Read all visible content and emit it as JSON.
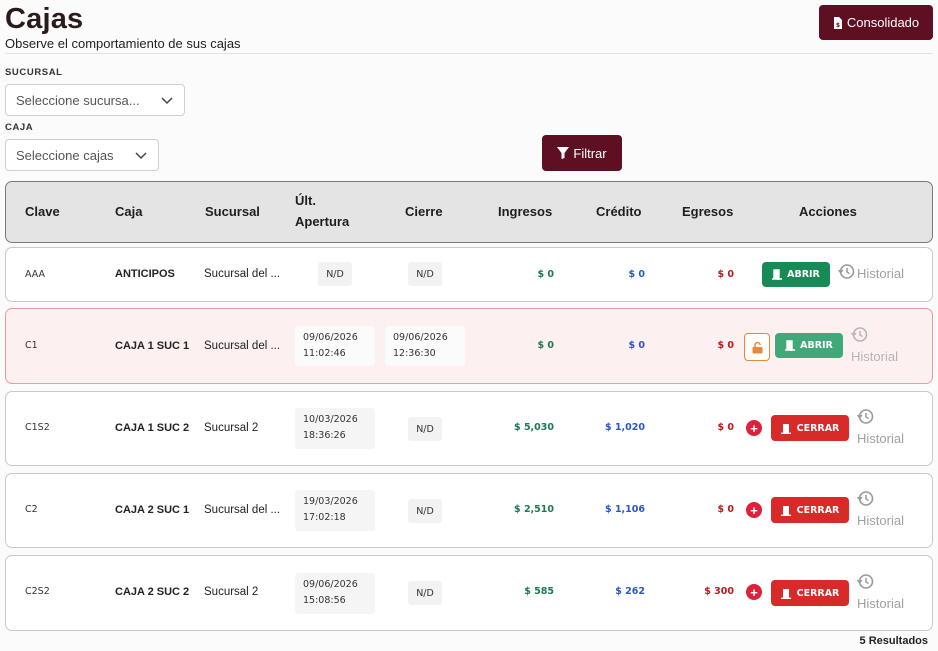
{
  "header": {
    "title": "Cajas",
    "subtitle": "Observe el comportamiento de sus cajas",
    "consolidado_label": "Consolidado"
  },
  "filters": {
    "sucursal_label": "SUCURSAL",
    "sucursal_placeholder": "Seleccione sucursa...",
    "caja_label": "CAJA",
    "caja_placeholder": "Seleccione cajas",
    "filtrar_label": "Filtrar"
  },
  "table": {
    "headers": {
      "clave": "Clave",
      "caja": "Caja",
      "sucursal": "Sucursal",
      "ult_apertura_1": "Últ.",
      "ult_apertura_2": "Apertura",
      "cierre": "Cierre",
      "ingresos": "Ingresos",
      "credito": "Crédito",
      "egresos": "Egresos",
      "acciones": "Acciones"
    },
    "rows": [
      {
        "clave": "AAA",
        "caja": "ANTICIPOS",
        "sucursal": "Sucursal del ...",
        "apertura": "N/D",
        "cierre": "N/D",
        "ingresos": "$ 0",
        "credito": "$ 0",
        "egresos": "$ 0",
        "action": "ABRIR",
        "historial": "Historial"
      },
      {
        "clave": "C1",
        "caja": "CAJA 1 SUC 1",
        "sucursal": "Sucursal del ...",
        "apertura_date": "09/06/2026",
        "apertura_time": "11:02:46",
        "cierre_date": "09/06/2026",
        "cierre_time": "12:36:30",
        "ingresos": "$ 0",
        "credito": "$ 0",
        "egresos": "$ 0",
        "action": "ABRIR",
        "historial": "Historial"
      },
      {
        "clave": "C1S2",
        "caja": "CAJA 1 SUC 2",
        "sucursal": "Sucursal 2",
        "apertura_date": "10/03/2026",
        "apertura_time": "18:36:26",
        "cierre": "N/D",
        "ingresos": "$ 5,030",
        "credito": "$ 1,020",
        "egresos": "$ 0",
        "action": "CERRAR",
        "historial": "Historial"
      },
      {
        "clave": "C2",
        "caja": "CAJA 2 SUC 1",
        "sucursal": "Sucursal del ...",
        "apertura_date": "19/03/2026",
        "apertura_time": "17:02:18",
        "cierre": "N/D",
        "ingresos": "$ 2,510",
        "credito": "$ 1,106",
        "egresos": "$ 0",
        "action": "CERRAR",
        "historial": "Historial"
      },
      {
        "clave": "C2S2",
        "caja": "CAJA 2 SUC 2",
        "sucursal": "Sucursal 2",
        "apertura_date": "09/06/2026",
        "apertura_time": "15:08:56",
        "cierre": "N/D",
        "ingresos": "$ 585",
        "credito": "$ 262",
        "egresos": "$ 300",
        "action": "CERRAR",
        "historial": "Historial"
      }
    ]
  },
  "footer": {
    "results": "5 Resultados"
  },
  "colors": {
    "primary": "#5e0f22",
    "success": "#178a55",
    "danger": "#d92a2a",
    "alert_bg": "#fdf0f1"
  }
}
